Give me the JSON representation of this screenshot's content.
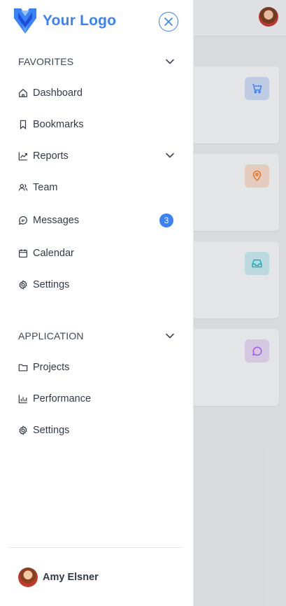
{
  "brand": {
    "logo_text": "Your Logo",
    "logo_icon": "hexagon-logo-icon",
    "accent": "#3b82f6"
  },
  "close": {
    "icon": "close-icon"
  },
  "favorites": {
    "title": "FAVORITES",
    "items": [
      {
        "label": "Dashboard",
        "icon": "home-icon"
      },
      {
        "label": "Bookmarks",
        "icon": "bookmark-icon"
      },
      {
        "label": "Reports",
        "icon": "trend-chart-icon",
        "expandable": true
      },
      {
        "label": "Team",
        "icon": "users-icon"
      },
      {
        "label": "Messages",
        "icon": "chat-icon",
        "badge": "3"
      },
      {
        "label": "Calendar",
        "icon": "calendar-icon"
      },
      {
        "label": "Settings",
        "icon": "gear-icon"
      }
    ]
  },
  "application": {
    "title": "APPLICATION",
    "items": [
      {
        "label": "Projects",
        "icon": "folder-icon"
      },
      {
        "label": "Performance",
        "icon": "bar-chart-icon"
      },
      {
        "label": "Settings",
        "icon": "gear-icon"
      }
    ]
  },
  "user": {
    "name": "Amy Elsner"
  },
  "background_cards": [
    {
      "icon": "cart-icon",
      "tile_color": "#c9d7f0",
      "icon_color": "#3b82f6"
    },
    {
      "icon": "map-pin-icon",
      "tile_color": "#f1d8c7",
      "icon_color": "#f97316"
    },
    {
      "icon": "inbox-icon",
      "tile_color": "#c7e6ea",
      "icon_color": "#06b6d4"
    },
    {
      "icon": "comment-icon",
      "tile_color": "#e0d3ef",
      "icon_color": "#a855f7"
    }
  ]
}
